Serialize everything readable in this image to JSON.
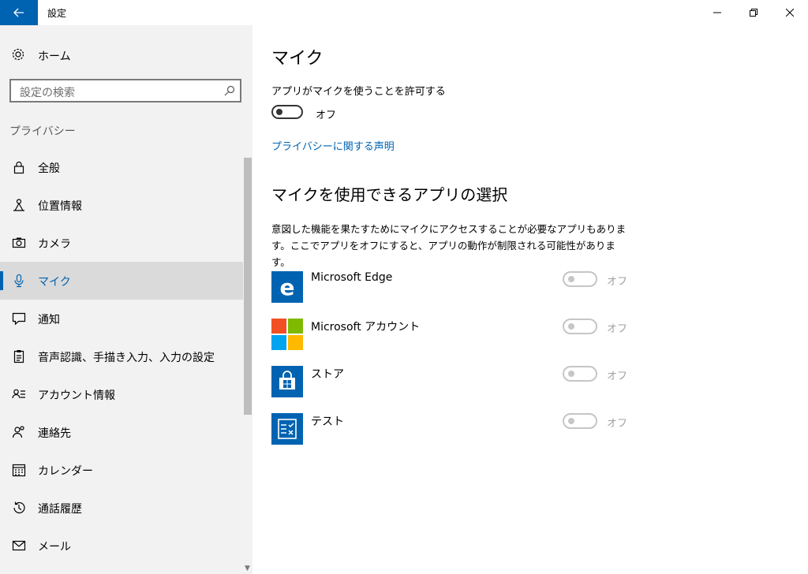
{
  "window": {
    "title": "設定"
  },
  "sidebar": {
    "home_label": "ホーム",
    "search_placeholder": "設定の検索",
    "section_label": "プライバシー",
    "items": [
      {
        "label": "全般",
        "icon": "lock-icon"
      },
      {
        "label": "位置情報",
        "icon": "location-icon"
      },
      {
        "label": "カメラ",
        "icon": "camera-icon"
      },
      {
        "label": "マイク",
        "icon": "microphone-icon",
        "selected": true
      },
      {
        "label": "通知",
        "icon": "notification-icon"
      },
      {
        "label": "音声認識、手描き入力、入力の設定",
        "icon": "clipboard-icon"
      },
      {
        "label": "アカウント情報",
        "icon": "account-info-icon"
      },
      {
        "label": "連絡先",
        "icon": "contacts-icon"
      },
      {
        "label": "カレンダー",
        "icon": "calendar-icon"
      },
      {
        "label": "通話履歴",
        "icon": "history-icon"
      },
      {
        "label": "メール",
        "icon": "mail-icon"
      }
    ]
  },
  "main": {
    "title": "マイク",
    "allow_label": "アプリがマイクを使うことを許可する",
    "allow_state": "オフ",
    "privacy_link": "プライバシーに関する声明",
    "apps_heading": "マイクを使用できるアプリの選択",
    "apps_description": "意図した機能を果たすためにマイクにアクセスすることが必要なアプリもあります。ここでアプリをオフにすると、アプリの動作が制限される可能性があります。",
    "apps": [
      {
        "name": "Microsoft Edge",
        "state": "オフ",
        "icon": "edge-icon"
      },
      {
        "name": "Microsoft アカウント",
        "state": "オフ",
        "icon": "microsoft-logo-icon"
      },
      {
        "name": "ストア",
        "state": "オフ",
        "icon": "store-icon"
      },
      {
        "name": "テスト",
        "state": "オフ",
        "icon": "test-app-icon"
      }
    ]
  },
  "colors": {
    "accent": "#0063b1",
    "sidebar_bg": "#f2f2f2",
    "selected_bg": "#dadada"
  }
}
